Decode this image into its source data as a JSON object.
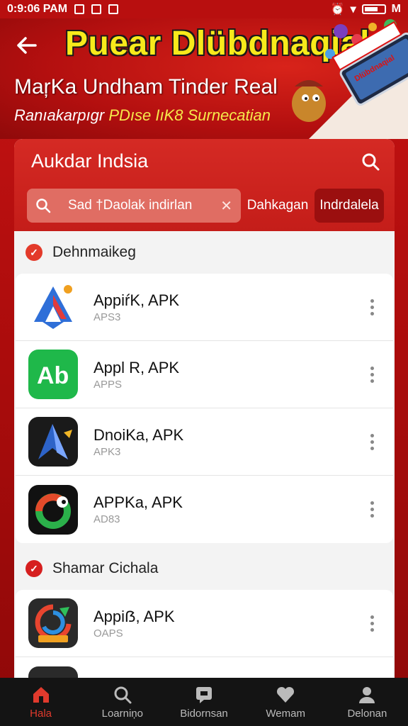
{
  "status_bar": {
    "time": "0:9:06 PAM",
    "right_text": "M"
  },
  "banner": {
    "title": "Puear Dlübdnaqial",
    "subtitle": "MaŗKa Undham Tinder Real",
    "tagline_white": "Ranıakarpıgr",
    "tagline_yellow": "PDıse IıK8 Surnecatian",
    "sticker_text": "Dlübdnaqial"
  },
  "card": {
    "title": "Aukdar Indsia",
    "search": {
      "placeholder": "Sad †Daolak indirlan"
    },
    "tabs": [
      {
        "label": "Dahkagan"
      },
      {
        "label": "Indrdalela"
      }
    ]
  },
  "sections": [
    {
      "label": "Dehnmaikeg",
      "apps": [
        {
          "name": "AppiŕK, APK",
          "sub": "APS3",
          "icon": "blue-a-logo-icon"
        },
        {
          "name": "Appl R, APK",
          "sub": "APPS",
          "icon": "green-ab-logo-icon"
        },
        {
          "name": "DnoiKa, APK",
          "sub": "APK3",
          "icon": "dark-arrow-logo-icon"
        },
        {
          "name": "APPKa, APK",
          "sub": "AD83",
          "icon": "ring-logo-icon"
        }
      ]
    },
    {
      "label": "Shamar Cichala",
      "apps": [
        {
          "name": "Appiẞ, APK",
          "sub": "OAPS",
          "icon": "colorful-swirl-logo-icon"
        }
      ]
    }
  ],
  "bottom_nav": [
    {
      "label": "Hala",
      "icon": "home-icon"
    },
    {
      "label": "Loarniņo",
      "icon": "search-icon"
    },
    {
      "label": "Bidornsan",
      "icon": "message-icon"
    },
    {
      "label": "Wemam",
      "icon": "heart-icon"
    },
    {
      "label": "Delonan",
      "icon": "profile-icon"
    }
  ],
  "colors": {
    "primary_red": "#c81414",
    "accent_yellow": "#f7ea1b",
    "nav_active": "#e03a2d",
    "nav_bg": "#141414"
  }
}
